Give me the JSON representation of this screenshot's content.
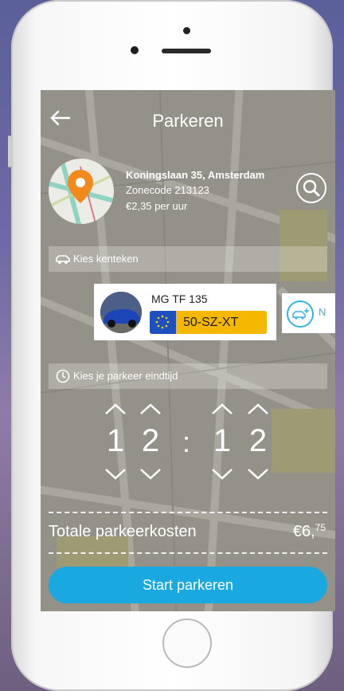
{
  "header": {
    "title": "Parkeren",
    "back_icon": "arrow-left-icon"
  },
  "location": {
    "address": "Koningslaan 35, Amsterdam",
    "zone": "Zonecode 213123",
    "rate": "€2,35 per uur",
    "pin_color": "#f08a1c"
  },
  "license_section": {
    "label": "Kies kenteken"
  },
  "car": {
    "name": "MG TF 135",
    "plate": "50-SZ-XT"
  },
  "add_car": {
    "label": "N"
  },
  "time_section": {
    "label": "Kies je parkeer eindtijd"
  },
  "time": {
    "h1": "1",
    "h2": "2",
    "separator": ":",
    "m1": "1",
    "m2": "2"
  },
  "total": {
    "label": "Totale parkeerkosten",
    "main": "€6,",
    "cents": "75"
  },
  "start_button": {
    "label": "Start parkeren"
  },
  "colors": {
    "accent": "#19a8df",
    "plate": "#f6b700",
    "eu_blue": "#1d4fbf"
  }
}
